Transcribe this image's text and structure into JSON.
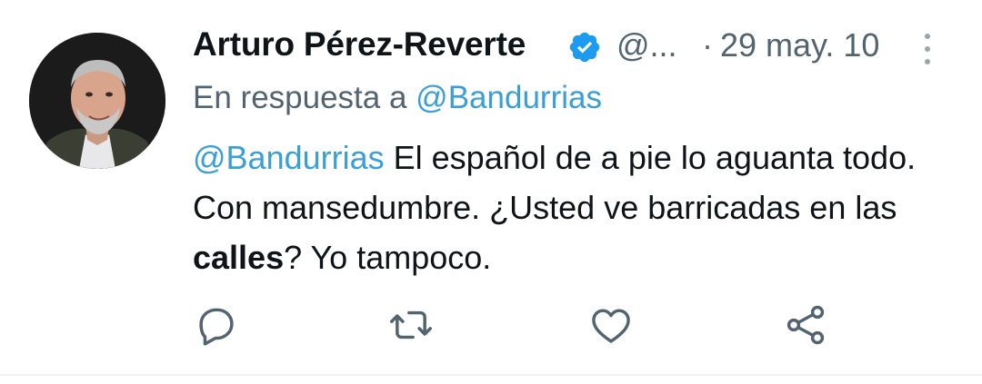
{
  "tweet": {
    "author_name": "Arturo Pérez-Reverte",
    "handle": "@...",
    "separator": "·",
    "timestamp": "29 may. 10",
    "reply_prefix": "En respuesta a",
    "reply_to": "@Bandurrias",
    "body": {
      "mention": "@Bandurrias",
      "text_1": " El español de a pie lo aguanta todo. Con mansedumbre. ¿Usted ve barricadas en las ",
      "bold": "calles",
      "text_2": "? Yo tampoco."
    }
  },
  "icons": {
    "verified": "verified-badge-icon",
    "more": "more-vertical-icon",
    "reply": "reply-icon",
    "retweet": "retweet-icon",
    "like": "like-icon",
    "share": "share-icon"
  },
  "colors": {
    "accent": "#1d9bf0",
    "secondary_text": "#536471",
    "primary_text": "#0f1419"
  }
}
